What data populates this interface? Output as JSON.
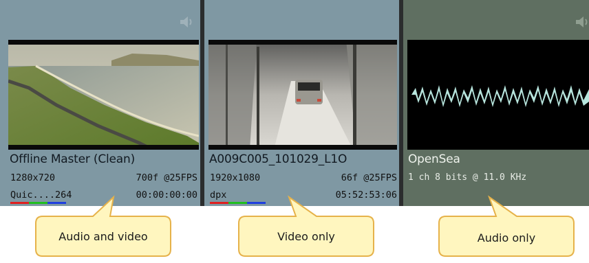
{
  "clips": [
    {
      "title": "Offline Master (Clean)",
      "resolution": "1280x720",
      "frames": "700f @25FPS",
      "codec": "Quic....264",
      "timecode": "00:00:00:00",
      "has_audio": true,
      "has_video": true
    },
    {
      "title": "A009C005_101029_L1O",
      "resolution": "1920x1080",
      "frames": "66f @25FPS",
      "codec": "dpx",
      "timecode": "05:52:53:06",
      "has_audio": false,
      "has_video": true
    },
    {
      "title": "OpenSea",
      "audio_info": "1 ch 8 bits @ 11.0 KHz",
      "has_audio": true,
      "has_video": false
    }
  ],
  "callouts": {
    "audio_video": "Audio and video",
    "video_only": "Video only",
    "audio_only": "Audio only"
  },
  "colors": {
    "video_tile": "#7f98a3",
    "audio_tile": "#5f6f61",
    "separator": "#2b2d2e",
    "callout_fill": "#fff6bf",
    "callout_border": "#e6b24a",
    "channel_red": "#e02020",
    "channel_green": "#1fbf1f",
    "channel_blue": "#1f3fe0",
    "waveform": "#b8e6de"
  },
  "icons": {
    "speaker": "speaker-icon"
  }
}
